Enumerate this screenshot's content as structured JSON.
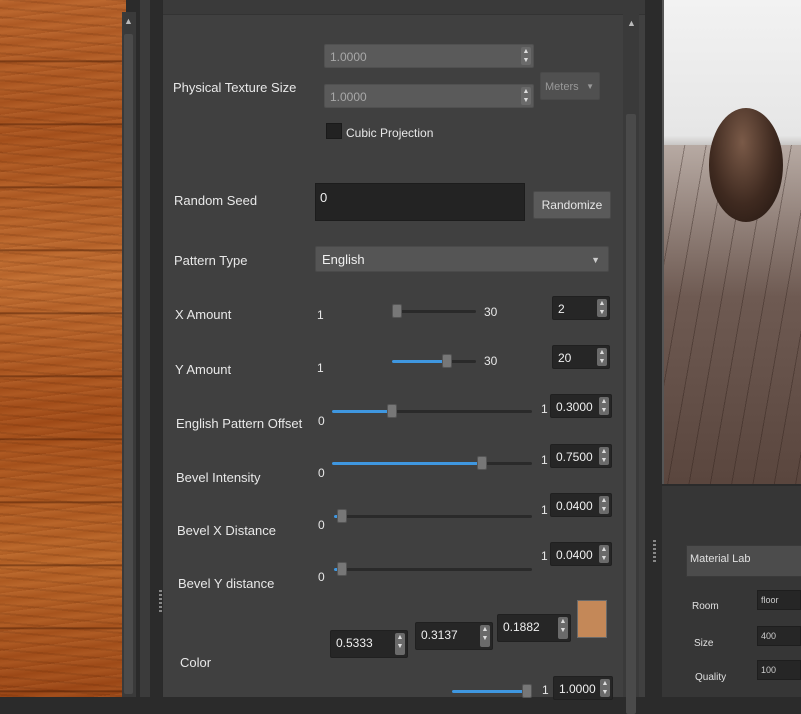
{
  "texture_size": {
    "label": "Physical Texture Size",
    "value1": "1.0000",
    "value2": "1.0000",
    "units": "Meters",
    "cubic_projection_label": "Cubic Projection"
  },
  "random_seed": {
    "label": "Random Seed",
    "value": "0",
    "button": "Randomize"
  },
  "pattern_type": {
    "label": "Pattern Type",
    "value": "English"
  },
  "x_amount": {
    "label": "X Amount",
    "min": "1",
    "max": "30",
    "value": "2",
    "level": 0.03
  },
  "y_amount": {
    "label": "Y Amount",
    "min": "1",
    "max": "30",
    "value": "20",
    "level": 0.66
  },
  "english_offset": {
    "label": "English Pattern Offset",
    "min": "0",
    "max": "1",
    "value": "0.3000",
    "level": 0.3
  },
  "bevel_intensity": {
    "label": "Bevel Intensity",
    "min": "0",
    "max": "1",
    "value": "0.7500",
    "level": 0.75
  },
  "bevel_x": {
    "label": "Bevel X Distance",
    "min": "0",
    "max": "1",
    "value": "0.0400",
    "level": 0.04
  },
  "bevel_y": {
    "label": "Bevel Y distance",
    "min": "0",
    "max": "1",
    "value": "0.0400",
    "level": 0.04
  },
  "color": {
    "label": "Color",
    "r": "0.5333",
    "g": "0.3137",
    "b": "0.1882",
    "swatch": "#c48858"
  },
  "bottom_row": {
    "max": "1",
    "value": "1.0000",
    "level": 1.0
  },
  "material_lab": {
    "title": "Material Lab",
    "room_label": "Room",
    "room_value": "floor",
    "size_label": "Size",
    "size_value": "400",
    "quality_label": "Quality",
    "quality_value": "100"
  },
  "colors": {
    "accent": "#3f97e0"
  }
}
